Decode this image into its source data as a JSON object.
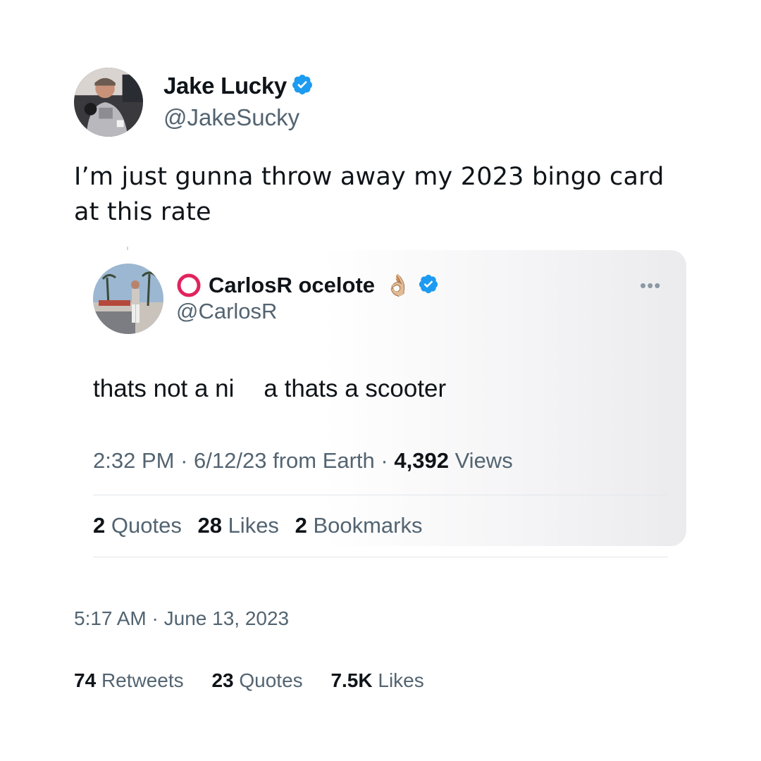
{
  "tweet": {
    "author": {
      "display_name": "Jake Lucky",
      "handle": "@JakeSucky",
      "verified": true
    },
    "text": "I’m just gunna throw away my 2023 bingo card at this rate",
    "time": "5:17 AM",
    "date": "June 13, 2023",
    "stats": [
      {
        "count": "74",
        "label": "Retweets"
      },
      {
        "count": "23",
        "label": "Quotes"
      },
      {
        "count": "7.5K",
        "label": "Likes"
      }
    ]
  },
  "quoted_tweet": {
    "author": {
      "display_name": "CarlosR ocelote",
      "handle": "@CarlosR",
      "verified": true,
      "emoji": "👌🏼"
    },
    "text_before": "thats not a ni",
    "text_after": "a thats a scooter",
    "time": "2:32 PM",
    "date": "6/12/23",
    "source": "from Earth",
    "views_count": "4,392",
    "views_label": "Views",
    "stats": [
      {
        "count": "2",
        "label": "Quotes"
      },
      {
        "count": "28",
        "label": "Likes"
      },
      {
        "count": "2",
        "label": "Bookmarks"
      }
    ],
    "more_label": "•••"
  },
  "colors": {
    "verified": "#1d9bf0",
    "secondary_text": "#536471",
    "ring": "#e0245e"
  },
  "icons": {
    "verified": "verified-badge-icon",
    "ring": "red-ring-icon",
    "more": "more-dots-icon"
  }
}
